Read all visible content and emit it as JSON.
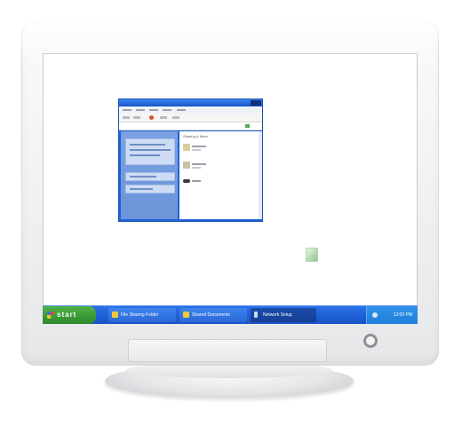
{
  "taskbar": {
    "start_label": "start",
    "tasks": [
      {
        "label": "File Sharing Folder"
      },
      {
        "label": "Shared Documents"
      },
      {
        "label": "Network Setup"
      }
    ],
    "clock": "12:00 PM"
  },
  "app_window": {
    "content_heading": "Sharing & More"
  },
  "colors": {
    "taskbar_blue": "#1e5fd6",
    "start_green": "#3a9a36",
    "tray_blue": "#1f7fd9"
  }
}
